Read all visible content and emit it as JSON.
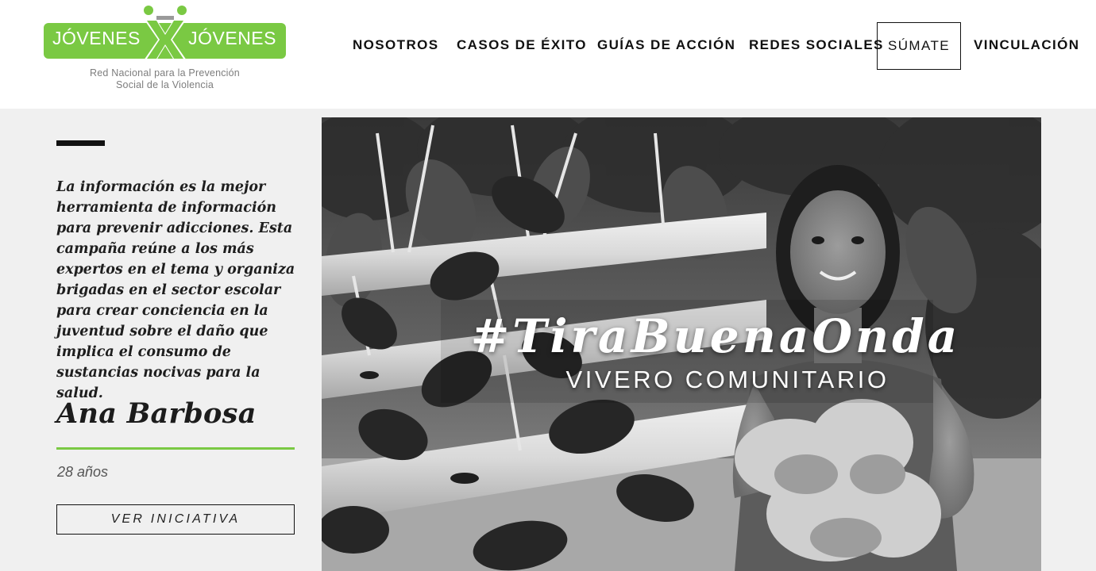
{
  "brand": {
    "word_left": "JÓVENES",
    "word_right": "JÓVENES",
    "tagline_line1": "Red Nacional para la Prevención",
    "tagline_line2": "Social de la Violencia",
    "accent_color": "#7ac943"
  },
  "nav": {
    "items": [
      {
        "label": "NOSOTROS"
      },
      {
        "label": "CASOS DE ÉXITO"
      },
      {
        "label": "GUÍAS DE ACCIÓN"
      },
      {
        "label": "REDES SOCIALES"
      },
      {
        "label": "SÚMATE"
      },
      {
        "label": "VINCULACIÓN"
      }
    ]
  },
  "story": {
    "quote": "La información es la mejor herramienta de información para prevenir adicciones. Esta campaña reúne a los más expertos en el tema y organiza brigadas en el sector escolar para crear conciencia en la juventud sobre el daño que implica el consumo de sustancias nocivas para la salud.",
    "name": "Ana Barbosa",
    "age": "28 años",
    "cta_label": "VER INICIATIVA"
  },
  "hero": {
    "title": "#TiraBuenaOnda",
    "subtitle": "VIVERO COMUNITARIO"
  }
}
